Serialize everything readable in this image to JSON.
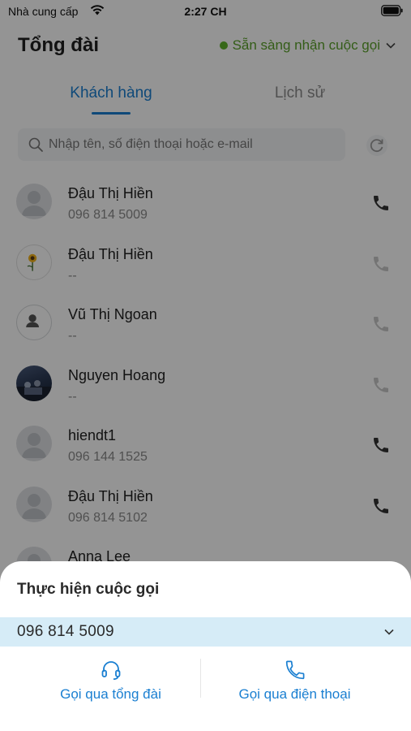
{
  "status_bar": {
    "carrier": "Nhà cung cấp",
    "time": "2:27 CH"
  },
  "header": {
    "title": "Tổng đài",
    "availability": "Sẵn sàng nhận cuộc gọi"
  },
  "tabs": [
    {
      "label": "Khách hàng",
      "active": true
    },
    {
      "label": "Lịch sử",
      "active": false
    }
  ],
  "search": {
    "placeholder": "Nhập tên, số điện thoại hoặc e-mail"
  },
  "contacts": [
    {
      "name": "Đậu Thị Hiền",
      "phone": "096 814 5009",
      "avatar": "default"
    },
    {
      "name": "Đậu Thị Hiền",
      "phone": "--",
      "avatar": "flower"
    },
    {
      "name": "Vũ Thị Ngoan",
      "phone": "--",
      "avatar": "outline"
    },
    {
      "name": "Nguyen Hoang",
      "phone": "--",
      "avatar": "photo"
    },
    {
      "name": "hiendt1",
      "phone": "096 144 1525",
      "avatar": "default"
    },
    {
      "name": "Đậu Thị Hiền",
      "phone": "096 814 5102",
      "avatar": "default"
    },
    {
      "name": "Anna Lee",
      "phone": "",
      "avatar": "default"
    }
  ],
  "sheet": {
    "title": "Thực hiện cuộc gọi",
    "selected_number": "096 814 5009",
    "options": [
      {
        "label": "Gọi qua tổng đài",
        "icon": "headset-icon"
      },
      {
        "label": "Gọi qua điện thoại",
        "icon": "phone-icon"
      }
    ]
  },
  "colors": {
    "accent": "#1a7fd1",
    "available": "#5fb32c",
    "select_bg": "#d6ecf7"
  }
}
